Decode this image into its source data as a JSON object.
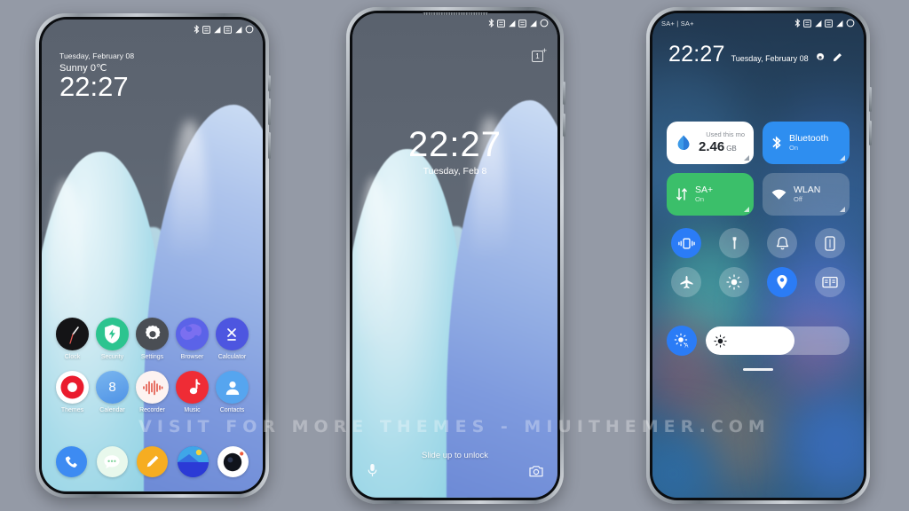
{
  "watermark": "VISIT FOR MORE THEMES - MIUITHEMER.COM",
  "colors": {
    "page_background": "#949aa6",
    "accent_blue": "#2b7cf6",
    "tile_bluetooth": "#2e8ef0",
    "tile_sa": "#3bbf6a",
    "tile_wlan": "rgba(255,255,255,0.20)",
    "tile_data": "#ffffff"
  },
  "phone_left": {
    "status_bar": {
      "icons": [
        "bluetooth-icon",
        "sim1-icon",
        "signal1-icon",
        "sim2-icon",
        "signal2-icon",
        "battery-icon"
      ]
    },
    "lock": {
      "date": "Tuesday, February 08",
      "weather": "Sunny 0℃",
      "time": "22:27"
    },
    "apps_row1": [
      {
        "label": "Clock",
        "icon": "clock-icon"
      },
      {
        "label": "Security",
        "icon": "security-icon"
      },
      {
        "label": "Settings",
        "icon": "settings-icon"
      },
      {
        "label": "Browser",
        "icon": "browser-icon"
      },
      {
        "label": "Calculator",
        "icon": "calculator-icon"
      }
    ],
    "apps_row2": [
      {
        "label": "Themes",
        "icon": "themes-icon"
      },
      {
        "label": "Calendar",
        "icon": "calendar-icon",
        "value": "8"
      },
      {
        "label": "Recorder",
        "icon": "recorder-icon"
      },
      {
        "label": "Music",
        "icon": "music-icon"
      },
      {
        "label": "Contacts",
        "icon": "contacts-icon"
      }
    ],
    "dock": [
      {
        "label": "Phone",
        "icon": "phone-icon"
      },
      {
        "label": "Messages",
        "icon": "messages-icon"
      },
      {
        "label": "Notes",
        "icon": "notes-icon"
      },
      {
        "label": "Gallery",
        "icon": "gallery-icon"
      },
      {
        "label": "Camera",
        "icon": "camera-icon"
      }
    ]
  },
  "phone_mid": {
    "status_bar": {
      "icons": [
        "bluetooth-icon",
        "sim1-icon",
        "signal1-icon",
        "sim2-icon",
        "signal2-icon",
        "battery-icon"
      ]
    },
    "brand": "1",
    "time": "22:27",
    "date": "Tuesday, Feb 8",
    "unlock_hint": "Slide up to unlock",
    "shortcut_left": "microphone-icon",
    "shortcut_right": "camera-icon"
  },
  "phone_right": {
    "status_bar": {
      "carrier": "SA+ | SA+",
      "icons": [
        "bluetooth-icon",
        "sim1-icon",
        "signal1-icon",
        "sim2-icon",
        "signal2-icon",
        "battery-icon"
      ]
    },
    "header": {
      "time": "22:27",
      "date": "Tuesday, February 08",
      "settings_icon": "gear-icon",
      "edit_icon": "pencil-icon"
    },
    "tiles": [
      {
        "name": "data-usage",
        "title": "Used this mo",
        "value": "2.46",
        "unit": "GB",
        "icon": "data-drop-icon",
        "state": "light"
      },
      {
        "name": "bluetooth",
        "title": "Bluetooth",
        "sub": "On",
        "icon": "bluetooth-icon",
        "state": "on"
      },
      {
        "name": "mobile-data",
        "title": "SA+",
        "sub": "On",
        "icon": "data-arrows-icon",
        "state": "on"
      },
      {
        "name": "wlan",
        "title": "WLAN",
        "sub": "Off",
        "icon": "wifi-icon",
        "state": "off"
      }
    ],
    "toggles": [
      {
        "name": "vibrate",
        "icon": "vibrate-icon",
        "state": "on"
      },
      {
        "name": "flashlight",
        "icon": "flashlight-icon",
        "state": "off"
      },
      {
        "name": "ringer",
        "icon": "bell-icon",
        "state": "off"
      },
      {
        "name": "cast",
        "icon": "cast-screen-icon",
        "state": "off"
      },
      {
        "name": "airplane-mode",
        "icon": "airplane-icon",
        "state": "off"
      },
      {
        "name": "auto-brightness",
        "icon": "sun-auto-icon",
        "state": "off"
      },
      {
        "name": "location",
        "icon": "location-pin-icon",
        "state": "on"
      },
      {
        "name": "reading-mode",
        "icon": "book-icon",
        "state": "off"
      }
    ],
    "brightness": {
      "auto_icon": "brightness-auto-icon",
      "slider_icon": "sun-icon",
      "percent": 62
    }
  }
}
